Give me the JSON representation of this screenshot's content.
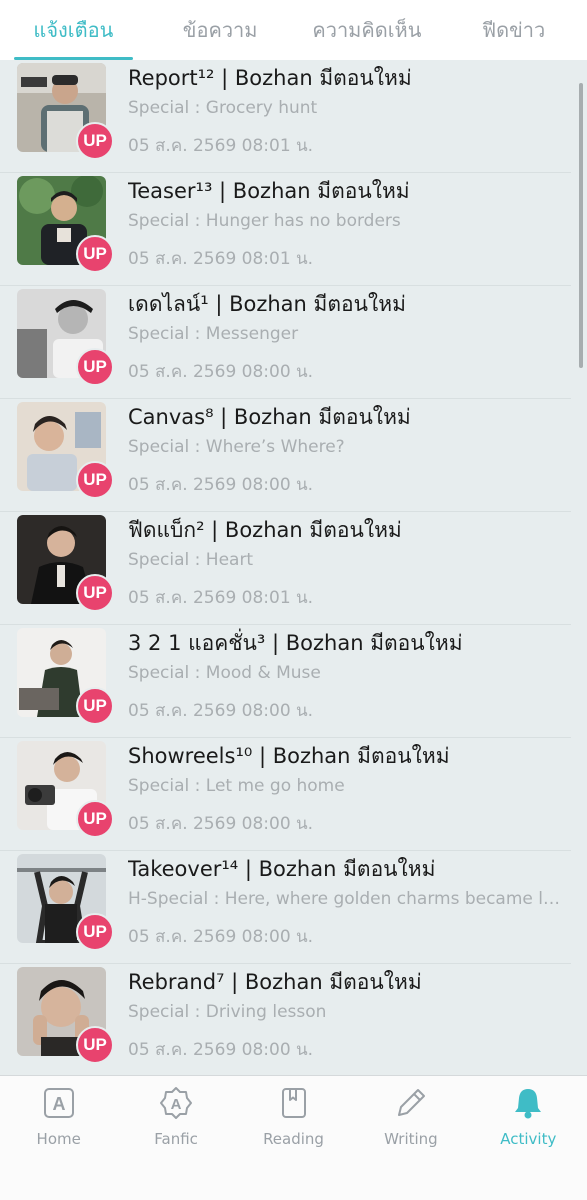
{
  "tabs": [
    {
      "label": "แจ้งเตือน",
      "active": true
    },
    {
      "label": "ข้อความ",
      "active": false
    },
    {
      "label": "ความคิดเห็น",
      "active": false
    },
    {
      "label": "ฟีดข่าว",
      "active": false
    }
  ],
  "notifications": [
    {
      "title": "Report¹² | Bozhan มีตอนใหม่",
      "subtitle": "Special : Grocery hunt",
      "time": "05 ส.ค. 2569 08:01 น.",
      "badge": "UP"
    },
    {
      "title": "Teaser¹³ | Bozhan มีตอนใหม่",
      "subtitle": "Special : Hunger has no borders",
      "time": "05 ส.ค. 2569 08:01 น.",
      "badge": "UP"
    },
    {
      "title": "เดดไลน์¹ | Bozhan มีตอนใหม่",
      "subtitle": "Special : Messenger",
      "time": "05 ส.ค. 2569 08:00 น.",
      "badge": "UP"
    },
    {
      "title": "Canvas⁸ | Bozhan มีตอนใหม่",
      "subtitle": "Special : Where’s Where?",
      "time": "05 ส.ค. 2569 08:00 น.",
      "badge": "UP"
    },
    {
      "title": "ฟีดแบ็ก² | Bozhan มีตอนใหม่",
      "subtitle": "Special : Heart",
      "time": "05 ส.ค. 2569 08:01 น.",
      "badge": "UP"
    },
    {
      "title": "3 2 1 แอคชั่น³ | Bozhan มีตอนใหม่",
      "subtitle": "Special : Mood & Muse",
      "time": "05 ส.ค. 2569 08:00 น.",
      "badge": "UP"
    },
    {
      "title": "Showreels¹⁰ | Bozhan มีตอนใหม่",
      "subtitle": "Special : Let me go home",
      "time": "05 ส.ค. 2569 08:00 น.",
      "badge": "UP"
    },
    {
      "title": "Takeover¹⁴ | Bozhan มีตอนใหม่",
      "subtitle": "H-Special : Here, where golden charms became lo...",
      "time": "05 ส.ค. 2569 08:00 น.",
      "badge": "UP"
    },
    {
      "title": "Rebrand⁷ | Bozhan มีตอนใหม่",
      "subtitle": "Special : Driving lesson",
      "time": "05 ส.ค. 2569 08:00 น.",
      "badge": "UP"
    }
  ],
  "bottom_nav": [
    {
      "label": "Home",
      "icon": "home-icon",
      "active": false
    },
    {
      "label": "Fanfic",
      "icon": "fanfic-icon",
      "active": false
    },
    {
      "label": "Reading",
      "icon": "book-icon",
      "active": false
    },
    {
      "label": "Writing",
      "icon": "pencil-icon",
      "active": false
    },
    {
      "label": "Activity",
      "icon": "bell-icon",
      "active": true
    }
  ],
  "colors": {
    "accent": "#3fbcc6",
    "badge": "#e8436e",
    "list_bg": "#e7edee"
  }
}
